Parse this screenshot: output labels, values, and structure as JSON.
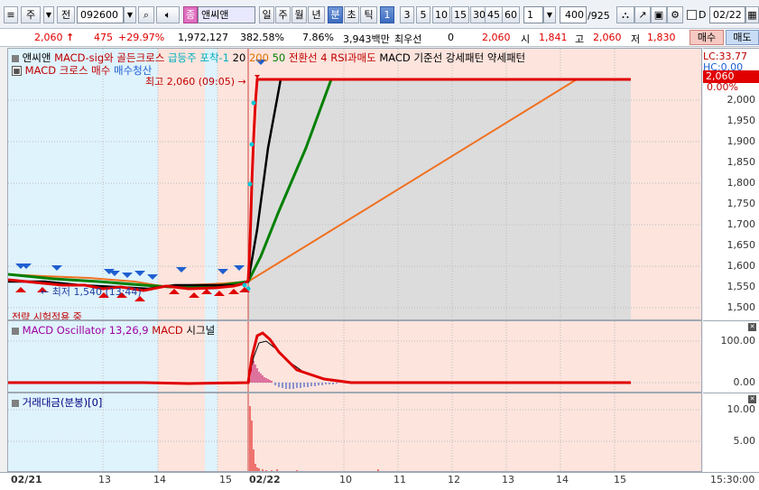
{
  "toolbar": {
    "market": "주",
    "prefix": "전",
    "code": "092600",
    "type_badge": "종",
    "name": "앤씨앤",
    "periods": [
      "일",
      "주",
      "월",
      "년",
      "분",
      "초",
      "틱"
    ],
    "active_period": "분",
    "intervals": [
      "1",
      "3",
      "5",
      "10",
      "15",
      "30",
      "45",
      "60"
    ],
    "active_interval": "1",
    "multiplier": "1",
    "count": "400",
    "total": "/925",
    "d_label": "D",
    "date": "02/22"
  },
  "quote": {
    "price": "2,060",
    "change": "475",
    "change_rate": "+29.97%",
    "volume": "1,972,127",
    "volume_ratio": "382.58%",
    "turnover_rate": "7.86%",
    "amount": "3,943백만",
    "bid_label": "최우선",
    "bid_value": "0",
    "current": "2,060",
    "open_label": "시",
    "open": "1,841",
    "high_label": "고",
    "high": "2,060",
    "low_label": "저",
    "low": "1,830",
    "buy_label": "매수",
    "sell_label": "매도"
  },
  "price_pane": {
    "legend_line1": [
      {
        "text": "앤씨앤",
        "color": "#000000"
      },
      {
        "text": "MACD-sig와 골든크로스",
        "color": "#c00000"
      },
      {
        "text": "급등주 포착-1",
        "color": "#00b0c0"
      },
      {
        "text": "20",
        "color": "#000000"
      },
      {
        "text": "200",
        "color": "#e07000"
      },
      {
        "text": "50",
        "color": "#008000"
      },
      {
        "text": "전환선 4",
        "color": "#c00000"
      },
      {
        "text": "RSI과매도",
        "color": "#c00000"
      },
      {
        "text": "MACD 기준선 강세패턴",
        "color": "#000000"
      },
      {
        "text": "약세패턴",
        "color": "#000000"
      }
    ],
    "legend_line2": [
      {
        "text": "MACD 크로스 매수",
        "color": "#c00000"
      },
      {
        "text": "매수청산",
        "color": "#1f5fd0"
      }
    ],
    "high_note": "최고 2,060 (09:05)",
    "low_note": "최저 1,540 (13:44)",
    "strategy_note": "전략 시험적용 중",
    "lc_label": "LC:33.77",
    "hc_label": "HC:0.00",
    "current_tag": "2,060",
    "pct_label": "0.00%",
    "y_ticks": [
      "2,000",
      "1,950",
      "1,900",
      "1,850",
      "1,800",
      "1,750",
      "1,700",
      "1,650",
      "1,600",
      "1,550",
      "1,500"
    ]
  },
  "macd_pane": {
    "legend": [
      {
        "text": "MACD Oscillator 13,26,9",
        "color": "#a000a0"
      },
      {
        "text": "MACD",
        "color": "#c00000"
      },
      {
        "text": "시그널",
        "color": "#000000"
      }
    ],
    "y_ticks": [
      "100.00",
      "0.00"
    ]
  },
  "volume_pane": {
    "legend": [
      {
        "text": "거래대금(분봉)[0]",
        "color": "#000080"
      }
    ],
    "y_ticks": [
      "10.00",
      "5.00"
    ]
  },
  "x_axis": {
    "labels": [
      "02/21",
      "13",
      "14",
      "15",
      "02/22",
      "10",
      "11",
      "12",
      "13",
      "14",
      "15"
    ],
    "time": "15:30:00"
  },
  "colors": {
    "up": "#e00000",
    "down": "#1f5fd0",
    "shade_blue": "#dff3fd",
    "shade_pink": "#fde4dd",
    "highlight": "#c8dcf8"
  }
}
